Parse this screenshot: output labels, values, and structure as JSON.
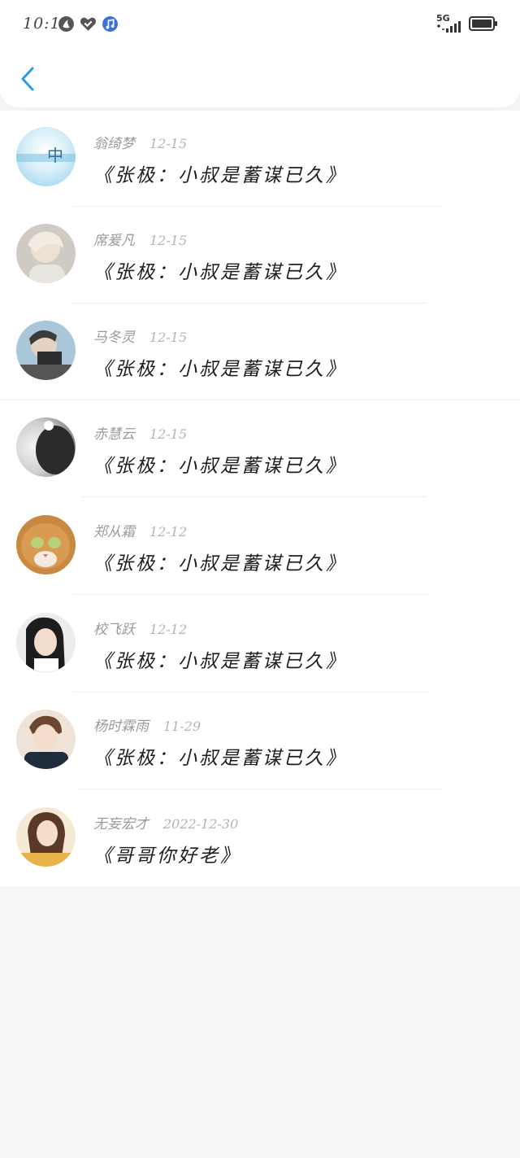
{
  "status_bar": {
    "time": "10:15",
    "network": "5G",
    "left_icons": [
      "gyroscope-icon",
      "heart-badge-icon",
      "music-note-icon"
    ],
    "right_icons": [
      "signal-strength-icon",
      "battery-icon"
    ]
  },
  "header": {
    "back_icon": "chevron-left-icon",
    "accent_color": "#2a9de6"
  },
  "items": [
    {
      "author": "翁绮梦",
      "date": "12-15",
      "title": "《张极：小叔是蓄谋已久》"
    },
    {
      "author": "席爰凡",
      "date": "12-15",
      "title": "《张极：小叔是蓄谋已久》"
    },
    {
      "author": "马冬灵",
      "date": "12-15",
      "title": "《张极：小叔是蓄谋已久》"
    },
    {
      "author": "赤慧云",
      "date": "12-15",
      "title": "《张极：小叔是蓄谋已久》"
    },
    {
      "author": "郑从霜",
      "date": "12-12",
      "title": "《张极：小叔是蓄谋已久》"
    },
    {
      "author": "校飞跃",
      "date": "12-12",
      "title": "《张极：小叔是蓄谋已久》"
    },
    {
      "author": "杨时霖雨",
      "date": "11-29",
      "title": "《张极：小叔是蓄谋已久》"
    },
    {
      "author": "无妄宏才",
      "date": "2022-12-30",
      "title": "《哥哥你好老》"
    }
  ]
}
